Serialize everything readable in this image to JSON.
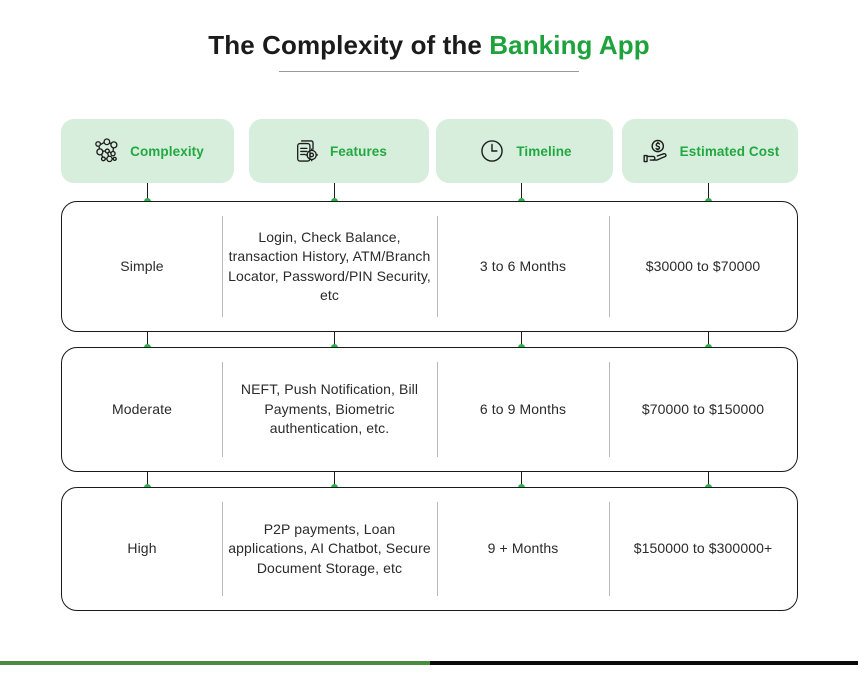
{
  "title": {
    "prefix": "The Complexity of the ",
    "accent": "Banking App"
  },
  "colors": {
    "accent_green": "#1ea23c",
    "pill_bg": "#d7eedd",
    "pill_text": "#22a840",
    "dot_green": "#2bb24c",
    "bar_green": "#4a8c3f",
    "bar_black": "#0a0a0a",
    "text": "#2a2a2a"
  },
  "headers": [
    {
      "label": "Complexity",
      "icon": "network-nodes-icon"
    },
    {
      "label": "Features",
      "icon": "document-gear-icon"
    },
    {
      "label": "Timeline",
      "icon": "clock-icon"
    },
    {
      "label": "Estimated Cost",
      "icon": "hand-holding-dollar-icon"
    }
  ],
  "rows": [
    {
      "complexity": "Simple",
      "features": "Login, Check Balance, transaction History, ATM/Branch Locator, Password/PIN Security, etc",
      "timeline": "3 to 6 Months",
      "cost": "$30000 to $70000"
    },
    {
      "complexity": "Moderate",
      "features": "NEFT, Push Notification, Bill Payments, Biometric authentication, etc.",
      "timeline": "6 to 9 Months",
      "cost": "$70000 to $150000"
    },
    {
      "complexity": "High",
      "features": "P2P payments, Loan applications, AI Chatbot, Secure Document Storage, etc",
      "timeline": "9 + Months",
      "cost": "$150000 to $300000+"
    }
  ]
}
